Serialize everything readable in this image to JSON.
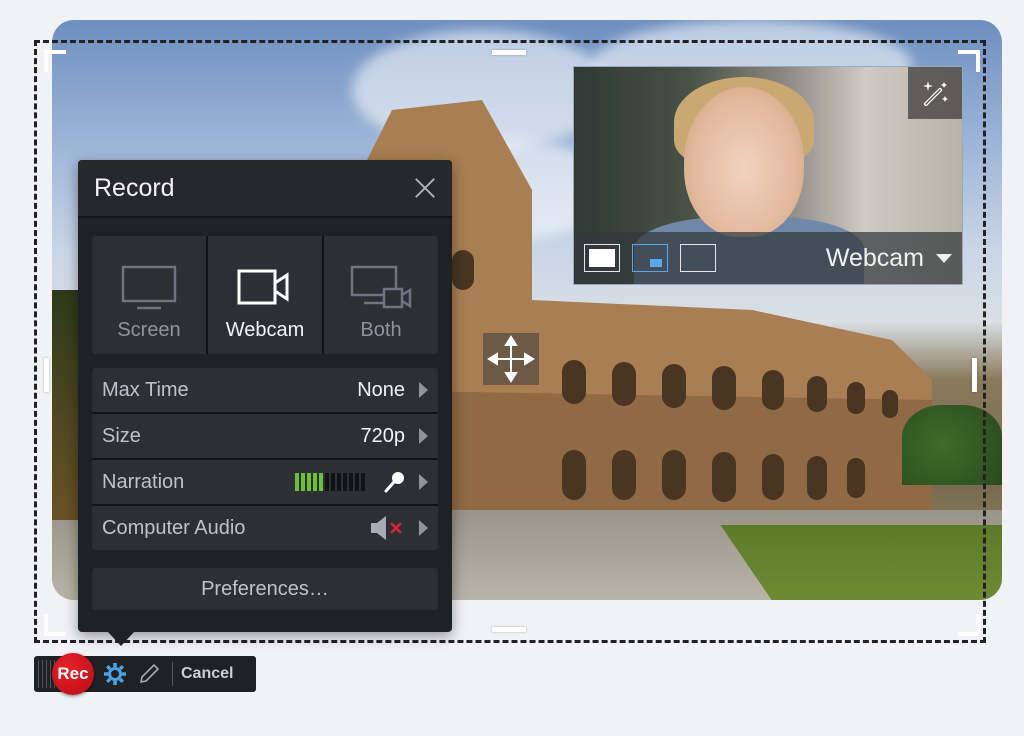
{
  "record_panel": {
    "title": "Record",
    "modes": [
      {
        "label": "Screen",
        "icon": "monitor-icon",
        "selected": false
      },
      {
        "label": "Webcam",
        "icon": "video-camera-icon",
        "selected": true
      },
      {
        "label": "Both",
        "icon": "monitor-camera-icon",
        "selected": false
      }
    ],
    "settings": [
      {
        "label": "Max Time",
        "value": "None"
      },
      {
        "label": "Size",
        "value": "720p"
      },
      {
        "label": "Narration",
        "meter_level": 5,
        "meter_total": 12,
        "icon": "microphone-icon"
      },
      {
        "label": "Computer Audio",
        "icon": "speaker-muted-icon",
        "muted": true
      }
    ],
    "preferences_label": "Preferences…"
  },
  "webcam_preview": {
    "source_label": "Webcam",
    "layouts": [
      "fullscreen",
      "picture-in-picture",
      "empty"
    ],
    "selected_layout": "picture-in-picture",
    "accent": "#5aa8ea"
  },
  "toolbar": {
    "rec_label": "Rec",
    "cancel_label": "Cancel",
    "rec_color": "#d4161f",
    "gear_color": "#4ba3e8"
  },
  "meter_colors": {
    "on": "#6bbf3a",
    "off": "#121315"
  }
}
